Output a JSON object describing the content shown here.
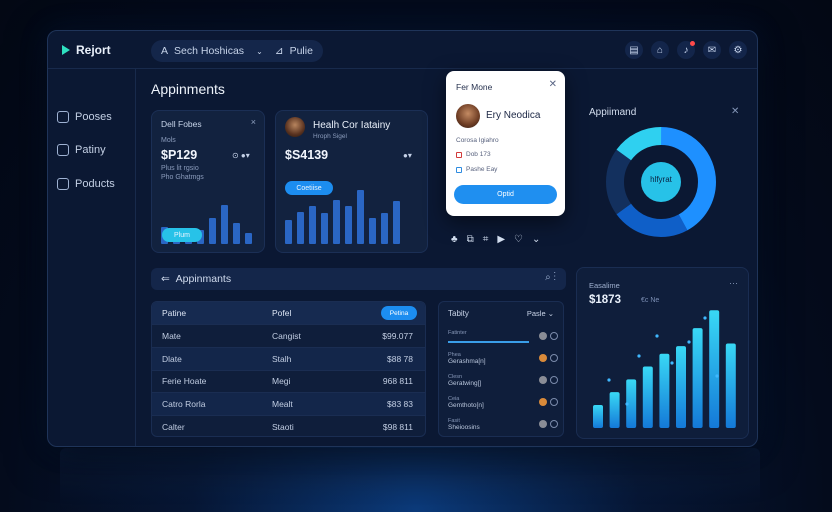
{
  "app": {
    "brand": "Rejort"
  },
  "search": {
    "text": "Sech Hoshicas"
  },
  "header_filter": {
    "label": "Pulie"
  },
  "sidebar": {
    "items": [
      {
        "label": "Pooses"
      },
      {
        "label": "Patiny"
      },
      {
        "label": "Poducts"
      }
    ]
  },
  "main": {
    "title": "Appinments"
  },
  "card1": {
    "title": "Dell Fobes",
    "sub_label": "Mols",
    "value": "$P129",
    "lines": [
      "Plus lit rgsio",
      "Pho Ghatmgs"
    ],
    "button": "Plum",
    "bars": [
      0.34,
      0.22,
      0.16,
      0.28,
      0.52,
      0.78,
      0.42,
      0.22
    ]
  },
  "card2": {
    "title": "Healh Cor Iatainy",
    "subtitle": "Hroph Sigel",
    "value": "$S4139",
    "button": "Coetiise",
    "bars": [
      0.42,
      0.58,
      0.68,
      0.56,
      0.78,
      0.68,
      0.96,
      0.46,
      0.56,
      0.76
    ]
  },
  "modal": {
    "title": "Fer Mone",
    "name": "Ery Neodica",
    "lines": [
      "Corosa Igiahro",
      "Dob 173",
      "Pashe Eay"
    ],
    "button": "Optid"
  },
  "donut": {
    "title": "Appiimand",
    "center": "hlfyrat",
    "segments": [
      0.42,
      0.23,
      0.2,
      0.15
    ]
  },
  "filterbar": {
    "label": "Appinmants"
  },
  "table": {
    "headers": [
      "Patine",
      "Pofel",
      "Petina"
    ],
    "rows": [
      [
        "Mate",
        "Cangist",
        "$99.077"
      ],
      [
        "Dlate",
        "Stalh",
        "$88 78"
      ],
      [
        "Ferie Hoate",
        "Megi",
        "968 811"
      ],
      [
        "Catro Rorla",
        "Mealt",
        "$83 83"
      ],
      [
        "Calter",
        "Staoti",
        "$98 811"
      ]
    ]
  },
  "panel2": {
    "header": "Tabity",
    "right": "Pasle",
    "items": [
      {
        "l1": "Fatinter",
        "l2": "",
        "progress": 0.9,
        "dot": "#8a8d96"
      },
      {
        "l1": "Phea",
        "l2": "Gerashma[n]",
        "progress": 0,
        "dot": "#d98a3a"
      },
      {
        "l1": "Clesn",
        "l2": "Geratwing[]",
        "progress": 0,
        "dot": "#8a8d96"
      },
      {
        "l1": "Ceia",
        "l2": "Gemthoto[n]",
        "progress": 0,
        "dot": "#d98a3a"
      },
      {
        "l1": "Fasit",
        "l2": "Sheioosins",
        "progress": 0,
        "dot": "#8a8d96"
      }
    ]
  },
  "rightchart": {
    "label": "Easalime",
    "value": "$1873",
    "sub": "€c Ne",
    "bars": [
      0.18,
      0.28,
      0.38,
      0.48,
      0.58,
      0.64,
      0.78,
      0.92,
      0.66
    ]
  }
}
